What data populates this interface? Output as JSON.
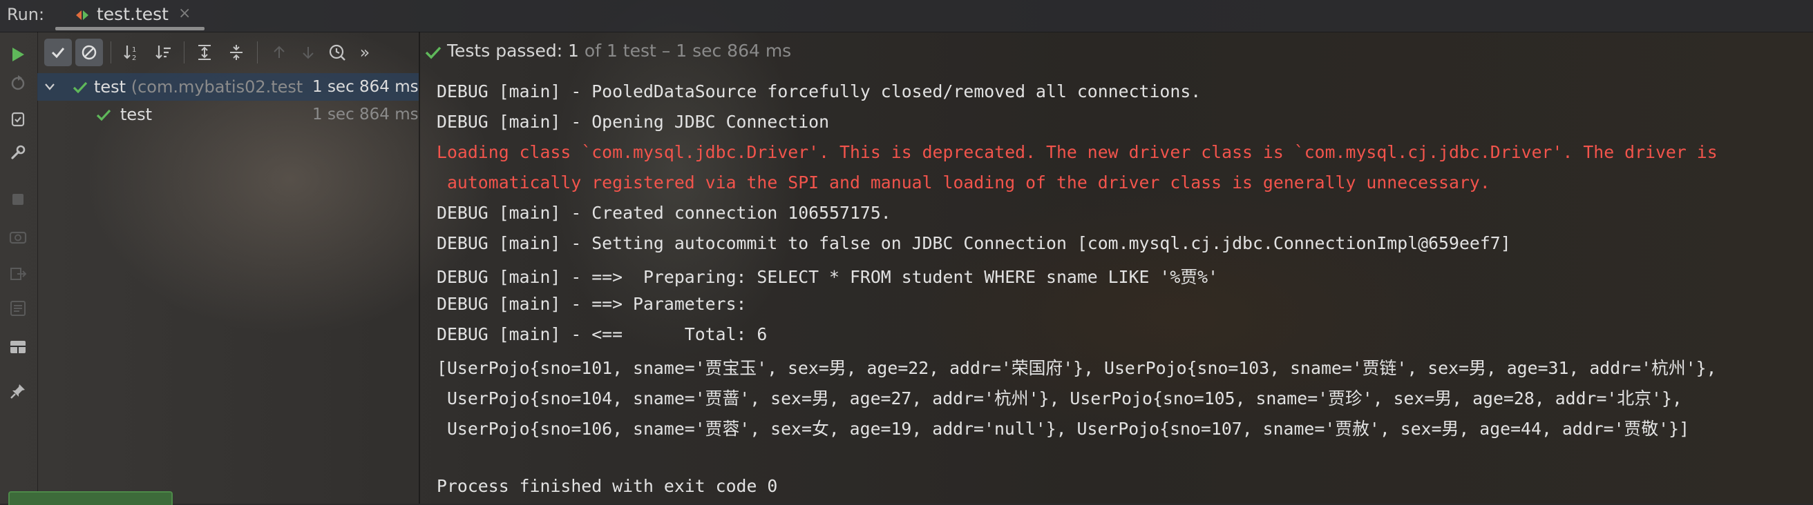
{
  "run_bar": {
    "label": "Run:",
    "tab_title": "test.test",
    "tab_close": "×"
  },
  "test_toolbar": {
    "status_pass": "Tests passed: 1",
    "status_detail": " of 1 test – 1 sec 864 ms",
    "overflow": "»"
  },
  "tree": {
    "root_name": "test",
    "root_class": " (com.mybatis02.test",
    "root_time": "1 sec 864 ms",
    "child_name": "test",
    "child_time": "1 sec 864 ms"
  },
  "console": {
    "lines": [
      "DEBUG [main] - PooledDataSource forcefully closed/removed all connections.",
      "DEBUG [main] - Opening JDBC Connection",
      "Loading class `com.mysql.jdbc.Driver'. This is deprecated. The new driver class is `com.mysql.cj.jdbc.Driver'. The driver is",
      " automatically registered via the SPI and manual loading of the driver class is generally unnecessary.",
      "DEBUG [main] - Created connection 106557175.",
      "DEBUG [main] - Setting autocommit to false on JDBC Connection [com.mysql.cj.jdbc.ConnectionImpl@659eef7]",
      "DEBUG [main] - ==>  Preparing: SELECT * FROM student WHERE sname LIKE '%贾%'",
      "DEBUG [main] - ==> Parameters: ",
      "DEBUG [main] - <==      Total: 6",
      "[UserPojo{sno=101, sname='贾宝玉', sex=男, age=22, addr='荣国府'}, UserPojo{sno=103, sname='贾链', sex=男, age=31, addr='杭州'},",
      " UserPojo{sno=104, sname='贾蔷', sex=男, age=27, addr='杭州'}, UserPojo{sno=105, sname='贾珍', sex=男, age=28, addr='北京'},",
      " UserPojo{sno=106, sname='贾蓉', sex=女, age=19, addr='null'}, UserPojo{sno=107, sname='贾赦', sex=男, age=44, addr='贾敬'}]",
      "",
      "Process finished with exit code 0"
    ]
  },
  "colors": {
    "pass_green": "#5fb85a",
    "error_red": "#f2544c",
    "selection": "#2c405a"
  }
}
